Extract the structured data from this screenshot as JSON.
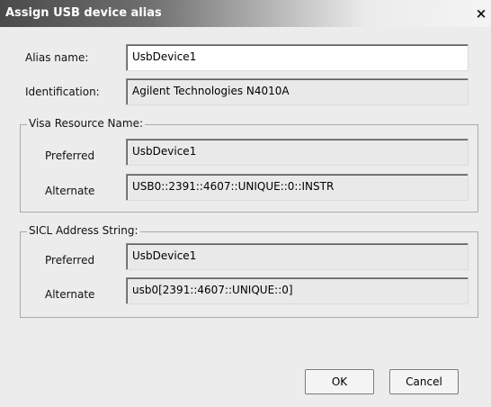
{
  "window": {
    "title": "Assign USB device alias",
    "close_glyph": "×"
  },
  "alias": {
    "label": "Alias name:",
    "value": "UsbDevice1"
  },
  "identification": {
    "label": "Identification:",
    "value": "Agilent Technologies N4010A"
  },
  "visa": {
    "group_title": "Visa Resource Name:",
    "preferred_label": "Preferred",
    "preferred_value": "UsbDevice1",
    "alternate_label": "Alternate",
    "alternate_value": "USB0::2391::4607::UNIQUE::0::INSTR"
  },
  "sicl": {
    "group_title": "SICL Address String:",
    "preferred_label": "Preferred",
    "preferred_value": "UsbDevice1",
    "alternate_label": "Alternate",
    "alternate_value": "usb0[2391::4607::UNIQUE::0]"
  },
  "buttons": {
    "ok": "OK",
    "cancel": "Cancel"
  }
}
